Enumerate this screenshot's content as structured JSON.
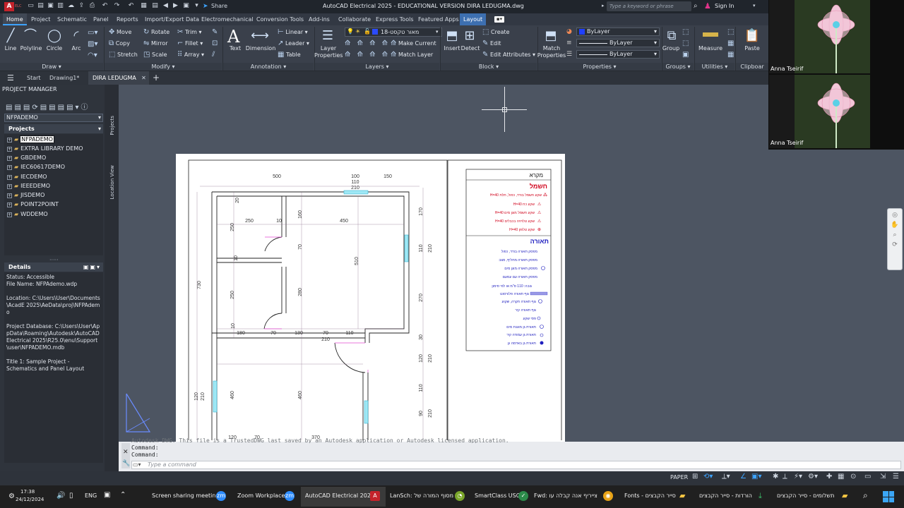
{
  "titlebar": {
    "app_badge": "A",
    "app_badge_sub": "ELC",
    "share": "Share",
    "title": "AutoCAD Electrical 2025 - EDUCATIONAL VERSION   DIRA LEDUGMA.dwg",
    "search_placeholder": "Type a keyword or phrase",
    "sign_in": "Sign In"
  },
  "ribbon_tabs": [
    "Home",
    "Project",
    "Schematic",
    "Panel",
    "Reports",
    "Import/Export Data",
    "Electromechanical",
    "Conversion Tools",
    "Add-ins",
    "Collaborate",
    "Express Tools",
    "Featured Apps",
    "Layout"
  ],
  "ribbon": {
    "draw": {
      "label": "Draw",
      "line": "Line",
      "polyline": "Polyline",
      "circle": "Circle",
      "arc": "Arc"
    },
    "modify": {
      "label": "Modify",
      "move": "Move",
      "rotate": "Rotate",
      "trim": "Trim",
      "copy": "Copy",
      "mirror": "Mirror",
      "fillet": "Fillet",
      "stretch": "Stretch",
      "scale": "Scale",
      "array": "Array"
    },
    "annotation": {
      "label": "Annotation",
      "text": "Text",
      "dimension": "Dimension",
      "linear": "Linear",
      "leader": "Leader",
      "table": "Table"
    },
    "layers": {
      "label": "Layers",
      "layer_properties": "Layer Properties",
      "current_layer": "מאור טקסט-18",
      "make_current": "Make Current",
      "match_layer": "Match Layer"
    },
    "block": {
      "label": "Block",
      "insert": "Insert",
      "detect": "Detect",
      "create": "Create",
      "edit": "Edit",
      "edit_attributes": "Edit Attributes"
    },
    "properties": {
      "label": "Properties",
      "match_properties": "Match Properties",
      "color": "ByLayer",
      "linetype": "ByLayer",
      "lineweight": "ByLayer"
    },
    "groups": {
      "label": "Groups",
      "group": "Group"
    },
    "utilities": {
      "label": "Utilities",
      "measure": "Measure"
    },
    "clipboard": {
      "label": "Clipboar",
      "paste": "Paste"
    }
  },
  "doc_tabs": {
    "start": "Start",
    "drawing1": "Drawing1*",
    "active": "DIRA LEDUGMA"
  },
  "project_manager": {
    "title": "PROJECT MANAGER",
    "selector": "NFPADEMO",
    "projects_header": "Projects",
    "projects": [
      "NFPADEMO",
      "EXTRA LIBRARY DEMO",
      "GBDEMO",
      "IEC60617DEMO",
      "IECDEMO",
      "IEEEDEMO",
      "JISDEMO",
      "POINT2POINT",
      "WDDEMO"
    ],
    "details_header": "Details",
    "details": [
      "Status: Accessible\nFile Name: NFPAdemo.wdp",
      "Location: C:\\Users\\User\\Documents\\AcadE 2025\\AeData\\proj\\NFPAdemo",
      "Project Database: C:\\Users\\User\\AppData\\Roaming\\Autodesk\\AutoCAD Electrical 2025\\R25.0\\enu\\Support\\user\\NFPADEMO.mdb",
      "Title 1: Sample Project - Schematics and Panel Layout"
    ],
    "vtab_projects": "Projects",
    "vtab_location": "Location View"
  },
  "drawing": {
    "dims_top": [
      "500",
      "100",
      "150"
    ],
    "dims_inner_top": [
      "110",
      "210"
    ],
    "room_dims": [
      "250",
      "10",
      "450",
      "160",
      "70",
      "510",
      "250",
      "280",
      "10",
      "730",
      "180",
      "70",
      "130",
      "70",
      "110",
      "210",
      "460",
      "460",
      "120",
      "70",
      "370",
      "120",
      "210",
      "170",
      "110",
      "210",
      "270",
      "30",
      "120",
      "210",
      "110",
      "90",
      "20",
      "10",
      "20"
    ],
    "legend_title": "מקרא",
    "legend_power_header": "חשמל",
    "legend_power": [
      "H=40 שקע חשמל בודד, כפול, תלת",
      "H=40 שקע כח",
      "H=40 שקע חשמל מוגן מים",
      "H=40 שקע טלויזיה בכבלים",
      "H=40 שקע טלפון"
    ],
    "legend_light_header": "תאורה",
    "legend_light": [
      "מפסק תאורה בודד, כפול",
      "מפסק תאורה מחליף, מצב",
      "מפסק תאורה מוגן מים",
      "מפסק תאורה עם עמעם",
      "גובה: 110 ס\"מ או לפי סימון",
      "גוף תאורה פלורסנט",
      "גוף תאורה תקרה, שקוע",
      "גוף תאורה קיר",
      "פסי שקע",
      "תאורת גן מוגנת מים",
      "תאורת גן עמודה קיר",
      "תאורת גן באדמה גן"
    ]
  },
  "command": {
    "history_1": "Autodesk DWG. This file is a TrustedDWG last saved by an Autodesk application or Autodesk licensed application.",
    "history_2": "Command:",
    "history_3": "Command:",
    "placeholder": "Type a command"
  },
  "status": {
    "paper": "PAPER"
  },
  "taskbar": {
    "time": "17:38",
    "date": "24/12/2024",
    "lang": "ENG",
    "items": [
      "Screen sharing meeting",
      "Zoom Workplace",
      "AutoCAD Electrical 2025",
      "LanSch: מסוף המורה של",
      "SmartClass USC",
      "Fwd: צייריף אנה קבלה עו",
      "Fonts - סייר הקבצים",
      "הורדות - סייר הקבצים",
      "תשלומים - סייר הקבצים"
    ]
  },
  "video": {
    "name_1": "Anna Tseirif",
    "name_2": "Anna Tseirif"
  },
  "colors": {
    "accent": "#3da3ff",
    "legend_red": "#d0021b",
    "legend_blue": "#1f1fbf",
    "window_cyan": "#4fd0e8"
  }
}
